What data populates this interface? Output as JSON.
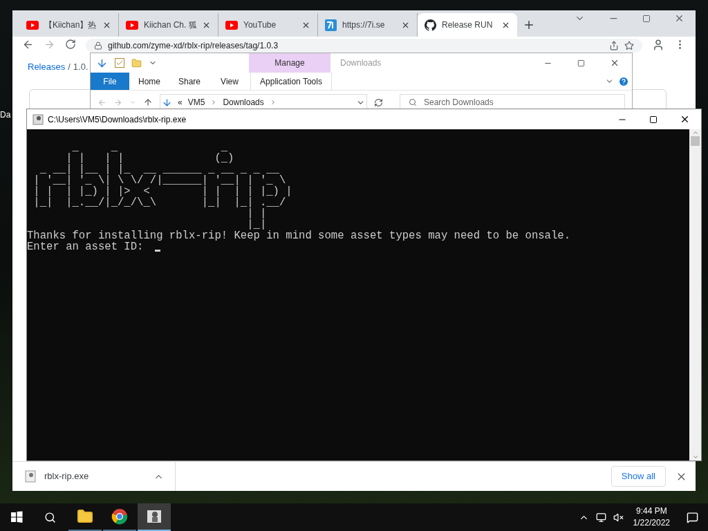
{
  "desktop": {
    "icon_label": "Da"
  },
  "browser": {
    "tabs": [
      {
        "title": "【Kiichan】热",
        "kind": "youtube",
        "selected": false
      },
      {
        "title": "Kiichan Ch. 狐",
        "kind": "youtube",
        "selected": false
      },
      {
        "title": "YouTube",
        "kind": "youtube",
        "selected": false
      },
      {
        "title": "https://7i.se",
        "kind": "seven",
        "selected": false
      },
      {
        "title": "Release RUN",
        "kind": "github",
        "selected": true
      }
    ],
    "address": "github.com/zyme-xd/rblx-rip/releases/tag/1.0.3",
    "breadcrumb": [
      "Releases",
      "/",
      "1.0."
    ],
    "download": "rblx-rip.exe",
    "show_all": "Show all"
  },
  "explorer": {
    "title": "Downloads",
    "ribbon_tabs": [
      {
        "label": "File",
        "kind": "file"
      },
      {
        "label": "Home",
        "kind": "plain"
      },
      {
        "label": "Share",
        "kind": "plain"
      },
      {
        "label": "View",
        "kind": "plain"
      }
    ],
    "context_group": "Manage",
    "context_tab": "Application Tools",
    "path_prefix": "«",
    "path": [
      "VM5",
      "Downloads"
    ],
    "search_placeholder": "Search Downloads"
  },
  "console": {
    "title": "C:\\Users\\VM5\\Downloads\\rblx-rip.exe",
    "art": [
      "       _     _                _",
      "      | |   | |              (_)",
      "  _ __| |__ | |_  __ ______ _ __ _ _ __",
      " | '__| '_ \\| \\ \\/ /|______| '__| | '_ \\",
      " | |  | |_) | |>  <        | |  | | |_) |",
      " |_|  |_.__/|_/_/\\_\\       |_|  |_| .__/",
      "                                  | |",
      "                                  |_|"
    ],
    "message": "Thanks for installing rblx-rip! Keep in mind some asset types may need to be onsale.",
    "prompt": "Enter an asset ID:"
  },
  "taskbar": {
    "apps": [
      {
        "kind": "folder",
        "selected": false
      },
      {
        "kind": "chrome",
        "selected": false
      },
      {
        "kind": "console",
        "selected": true
      }
    ],
    "time": "9:44 PM",
    "date": "1/22/2022"
  }
}
